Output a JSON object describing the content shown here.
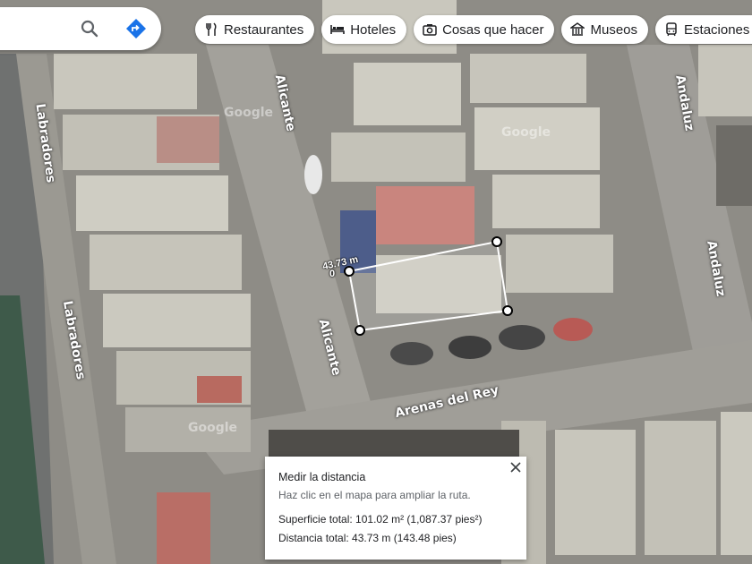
{
  "search": {
    "search_icon": "search-icon",
    "directions_icon": "directions-icon",
    "accent_color": "#1a73e8"
  },
  "chips": [
    {
      "label": "Restaurantes",
      "icon": "fork-knife-icon"
    },
    {
      "label": "Hoteles",
      "icon": "bed-icon"
    },
    {
      "label": "Cosas que hacer",
      "icon": "camera-icon"
    },
    {
      "label": "Museos",
      "icon": "museum-icon"
    },
    {
      "label": "Estaciones d",
      "icon": "transit-icon"
    }
  ],
  "roads": {
    "labradores": "Labradores",
    "alicante": "Alicante",
    "andaluz": "Andaluz",
    "arenas_del_rey": "Arenas del Rey"
  },
  "watermark": "Google",
  "measurement": {
    "segment_label": "43.73 m",
    "segment_label_2": "0",
    "panel_title": "Medir la distancia",
    "panel_hint": "Haz clic en el mapa para ampliar la ruta.",
    "total_area": "Superficie total: 101.02 m² (1,087.37 pies²)",
    "total_distance": "Distancia total: 43.73 m (143.48 pies)"
  }
}
